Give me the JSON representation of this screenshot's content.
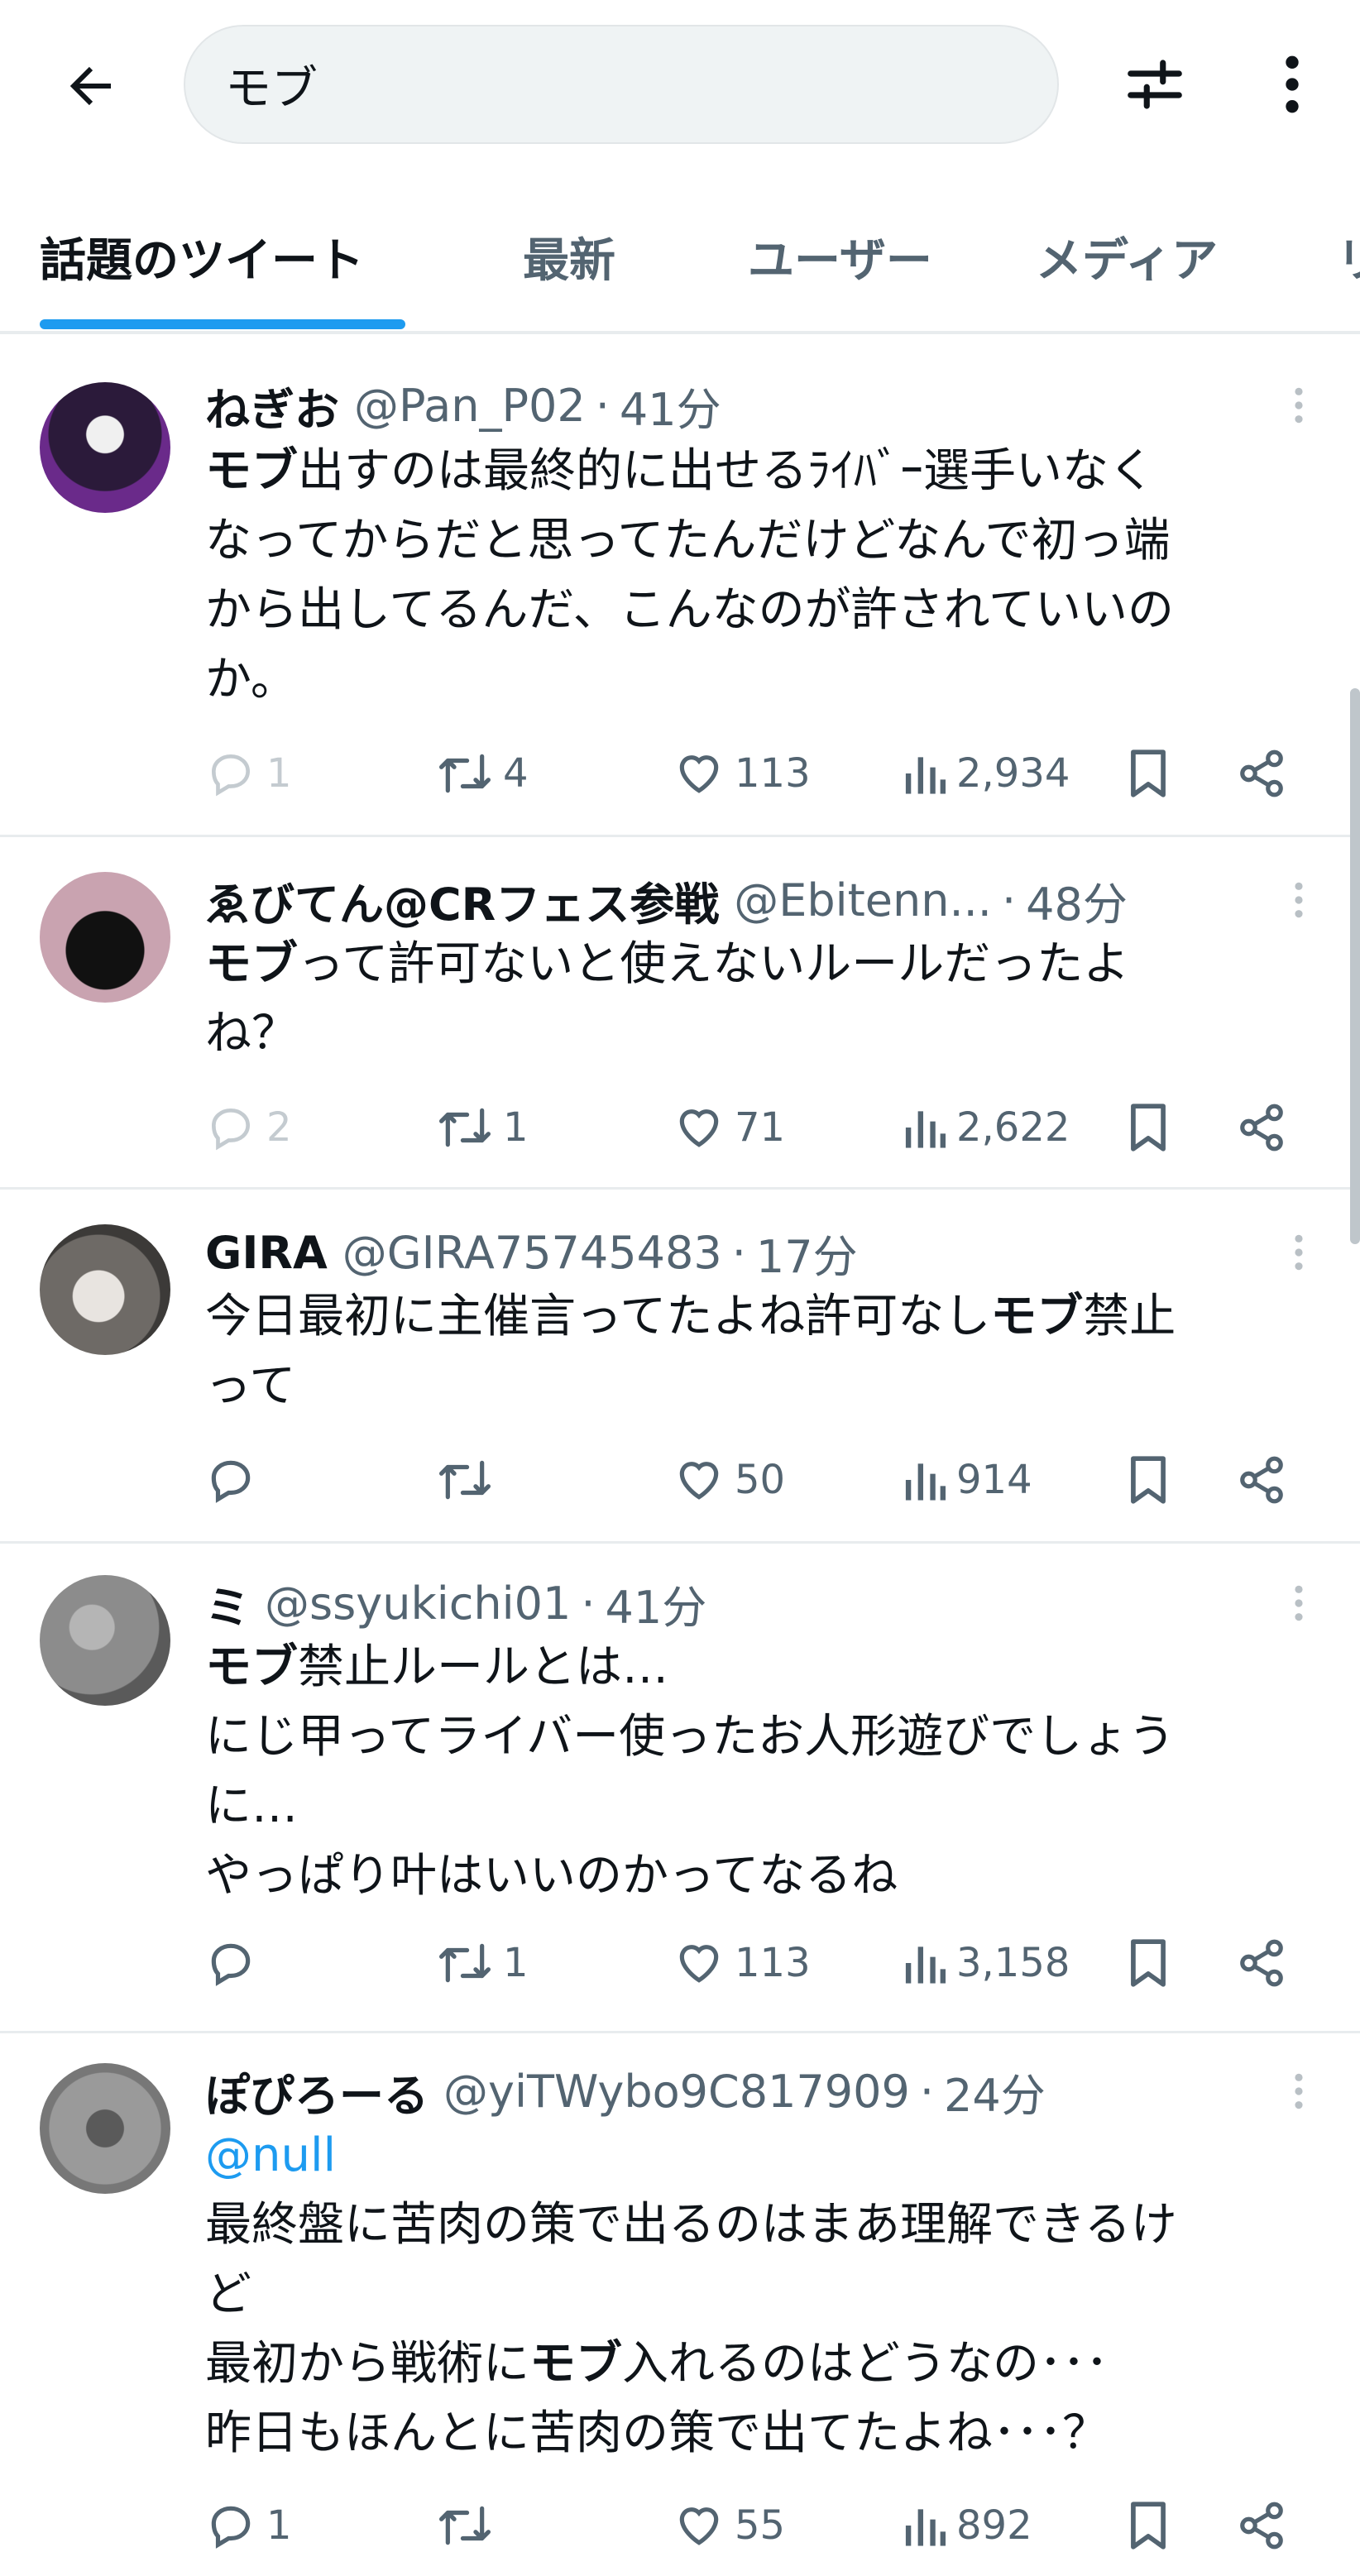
{
  "search": {
    "query": "モブ"
  },
  "tabs": [
    "話題のツイート",
    "最新",
    "ユーザー",
    "メディア",
    "リ"
  ],
  "tweets": [
    {
      "name": "ねぎお",
      "handle": "@Pan_P02",
      "time": "41分",
      "body_lines": [
        [
          {
            "t": "モブ",
            "b": true
          },
          {
            "t": "出すのは最終的に出せるﾗｲﾊﾞｰ選手いなく"
          }
        ],
        [
          {
            "t": "なってからだと思ってたんだけどなんで初っ端"
          }
        ],
        [
          {
            "t": "から出してるんだ、こんなのが許されていいの"
          }
        ],
        [
          {
            "t": "か。"
          }
        ]
      ],
      "replies": "1",
      "retweets": "4",
      "likes": "113",
      "views": "2,934",
      "avatar_color": "#3a1a4a"
    },
    {
      "name": "ゑびてん@CRフェス参戦",
      "handle": "@Ebitenn...",
      "time": "48分",
      "body_lines": [
        [
          {
            "t": "モブ",
            "b": true
          },
          {
            "t": "って許可ないと使えないルールだったよ"
          }
        ],
        [
          {
            "t": "ね？"
          }
        ]
      ],
      "replies": "2",
      "retweets": "1",
      "likes": "71",
      "views": "2,622",
      "avatar_color": "#c9a3b0"
    },
    {
      "name": "GIRA",
      "handle": "@GIRA75745483",
      "time": "17分",
      "body_lines": [
        [
          {
            "t": "今日最初に主催言ってたよね許可なし"
          },
          {
            "t": "モブ",
            "b": true
          },
          {
            "t": "禁止"
          }
        ],
        [
          {
            "t": "って"
          }
        ]
      ],
      "replies": "",
      "retweets": "",
      "likes": "50",
      "views": "914",
      "avatar_color": "#6e6a66"
    },
    {
      "name": "ミ",
      "handle": "@ssyukichi01",
      "time": "41分",
      "body_lines": [
        [
          {
            "t": "モブ",
            "b": true
          },
          {
            "t": "禁止ルールとは…"
          }
        ],
        [
          {
            "t": "にじ甲ってライバー使ったお人形遊びでしょう"
          }
        ],
        [
          {
            "t": "に…"
          }
        ],
        [
          {
            "t": "やっぱり叶はいいのかってなるね"
          }
        ]
      ],
      "replies": "",
      "retweets": "1",
      "likes": "113",
      "views": "3,158",
      "avatar_color": "#8c8c8c"
    },
    {
      "name": "ぽぴろーる",
      "handle": "@yiTWybo9C817909",
      "time": "24分",
      "mention": "@null",
      "body_lines": [
        [
          {
            "t": "最終盤に苦肉の策で出るのはまあ理解できるけ"
          }
        ],
        [
          {
            "t": "ど"
          }
        ],
        [
          {
            "t": "最初から戦術に"
          },
          {
            "t": "モブ",
            "b": true
          },
          {
            "t": "入れるのはどうなの･･･"
          }
        ],
        [
          {
            "t": "昨日もほんとに苦肉の策で出てたよね･･･？"
          }
        ]
      ],
      "replies": "1",
      "retweets": "",
      "likes": "55",
      "views": "892",
      "avatar_color": "#9a9a9a"
    }
  ]
}
